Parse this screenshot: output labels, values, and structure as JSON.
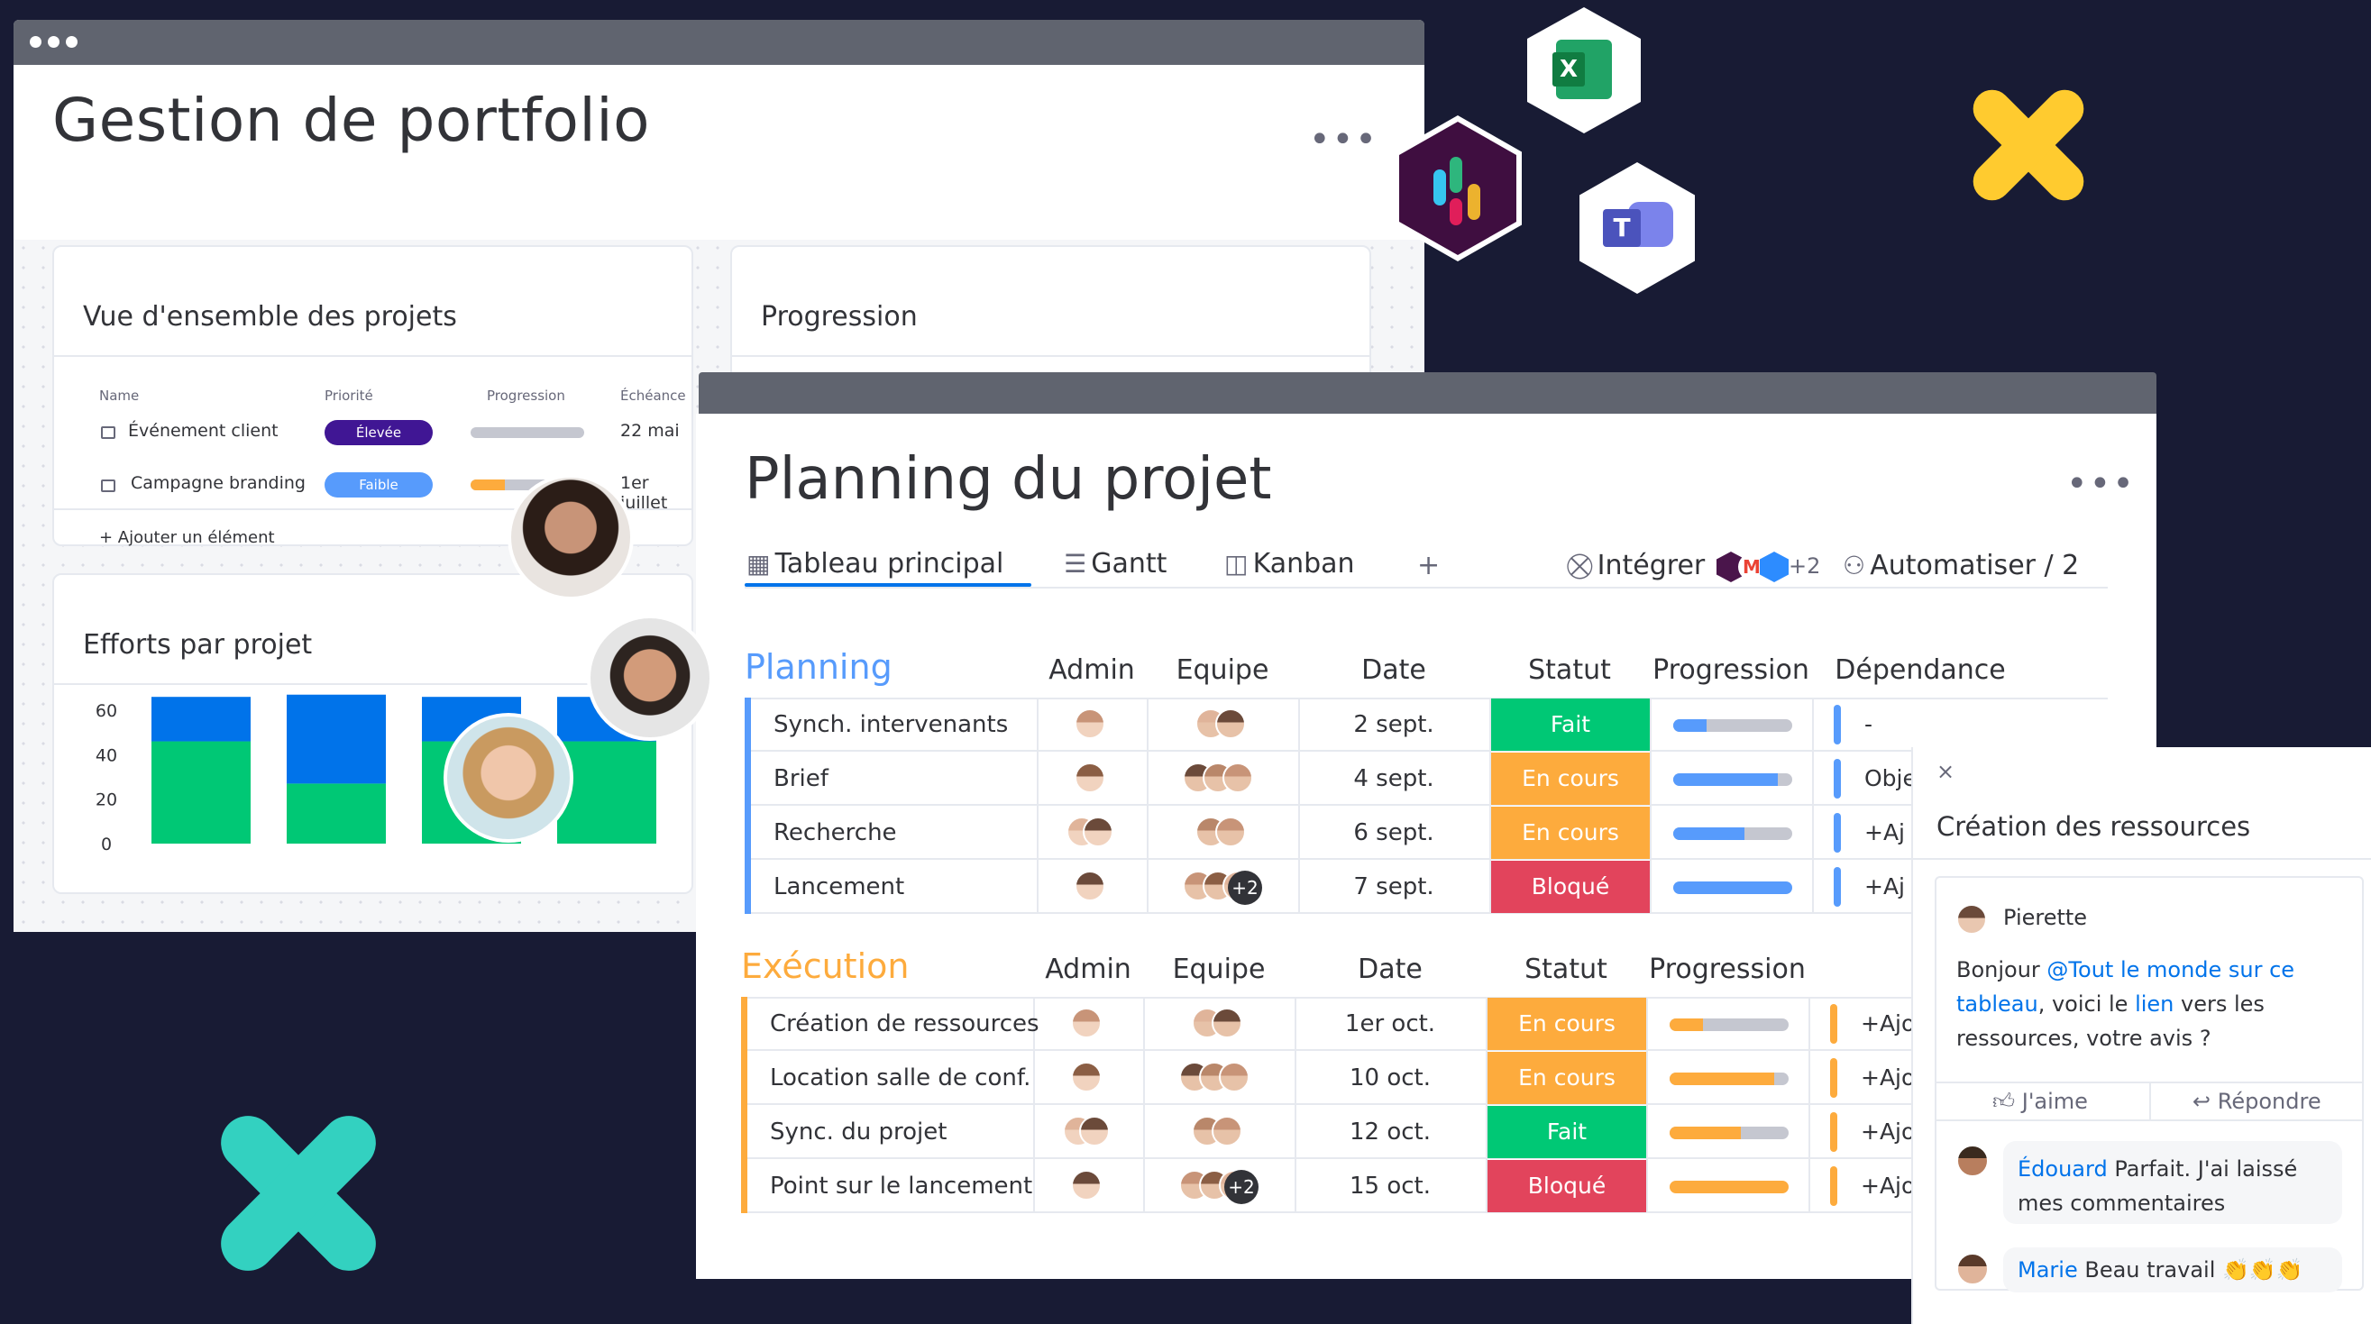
{
  "portfolio": {
    "title": "Gestion de portfolio",
    "overview": {
      "title": "Vue d'ensemble des projets",
      "headers": {
        "name": "Name",
        "priority": "Priorité",
        "progress": "Progression",
        "due": "Échéance"
      },
      "rows": [
        {
          "name": "Événement client",
          "priority": "Élevée",
          "priority_color": "#401694",
          "progress": 1.0,
          "progress_color": "#c5c7d0",
          "due": "22 mai"
        },
        {
          "name": "Campagne branding",
          "priority": "Faible",
          "priority_color": "#579bfc",
          "progress": 0.3,
          "progress_color": "#fdab3d",
          "due": "1er juillet"
        }
      ],
      "add_item": "+ Ajouter un élément"
    },
    "progress_card": {
      "title": "Progression"
    },
    "efforts": {
      "title": "Efforts par projet",
      "chart_data": {
        "type": "bar",
        "stacked": true,
        "ylim": [
          0,
          60
        ],
        "yticks": [
          "60",
          "40",
          "20",
          "0"
        ],
        "categories": [
          "",
          "",
          "",
          ""
        ],
        "series": [
          {
            "values": [
              46,
              27,
              46,
              46
            ],
            "color": "#00c875"
          },
          {
            "values": [
              20,
              40,
              20,
              20
            ],
            "color": "#0073ea"
          }
        ]
      }
    }
  },
  "planning": {
    "title": "Planning du projet",
    "tabs": [
      {
        "label": "Tableau principal",
        "icon": "table-icon"
      },
      {
        "label": "Gantt",
        "icon": "gantt-icon"
      },
      {
        "label": "Kanban",
        "icon": "kanban-icon"
      },
      {
        "label": "+",
        "icon": ""
      }
    ],
    "integrate": "Intégrer",
    "integrate_extra": "+2",
    "automate": "Automatiser / 2",
    "columns": {
      "admin": "Admin",
      "team": "Equipe",
      "date": "Date",
      "status": "Statut",
      "progress": "Progression",
      "dependency": "Dépendance"
    },
    "groups": [
      {
        "name": "Planning",
        "color": "#579bfc",
        "rows": [
          {
            "task": "Synch. intervenants",
            "date": "2 sept.",
            "status": "Fait",
            "status_color": "#00c875",
            "progress": 0.28,
            "dep": "-"
          },
          {
            "task": "Brief",
            "date": "4 sept.",
            "status": "En cours",
            "status_color": "#fdab3d",
            "progress": 0.88,
            "dep": "Obje"
          },
          {
            "task": "Recherche",
            "date": "6 sept.",
            "status": "En cours",
            "status_color": "#fdab3d",
            "progress": 0.6,
            "dep": "+Aj"
          },
          {
            "task": "Lancement",
            "date": "7 sept.",
            "status": "Bloqué",
            "status_color": "#e2445c",
            "progress": 1.0,
            "dep": "+Aj"
          }
        ]
      },
      {
        "name": "Exécution",
        "color": "#fdab3d",
        "rows": [
          {
            "task": "Création de ressources",
            "date": "1er oct.",
            "status": "En cours",
            "status_color": "#fdab3d",
            "progress": 0.28,
            "dep": "+Ajo"
          },
          {
            "task": "Location salle de conf.",
            "date": "10 oct.",
            "status": "En cours",
            "status_color": "#fdab3d",
            "progress": 0.88,
            "dep": "+Ajo"
          },
          {
            "task": "Sync. du projet",
            "date": "12 oct.",
            "status": "Fait",
            "status_color": "#00c875",
            "progress": 0.6,
            "dep": "+Ajo"
          },
          {
            "task": "Point sur le lancement",
            "date": "15 oct.",
            "status": "Bloqué",
            "status_color": "#e2445c",
            "progress": 1.0,
            "dep": "+Ajo"
          }
        ]
      }
    ],
    "team_extra": "+2"
  },
  "comments": {
    "close": "×",
    "title": "Création des ressources",
    "author": "Pierette",
    "msg_start": "Bonjour ",
    "msg_mention": "@Tout le monde sur ce tableau",
    "msg_mid": ", voici le ",
    "msg_link": "lien",
    "msg_end": " vers les ressources, votre avis ?",
    "like": "J'aime",
    "reply": "Répondre",
    "replies": [
      {
        "author": "Édouard",
        "text": " Parfait. J'ai laissé mes commentaires"
      },
      {
        "author": "Marie",
        "text": " Beau travail 👏👏👏"
      }
    ]
  },
  "colors": {
    "blue": "#0073ea",
    "green": "#00c875",
    "orange": "#fdab3d",
    "red": "#e2445c",
    "purple": "#401694",
    "background": "#181b34"
  }
}
